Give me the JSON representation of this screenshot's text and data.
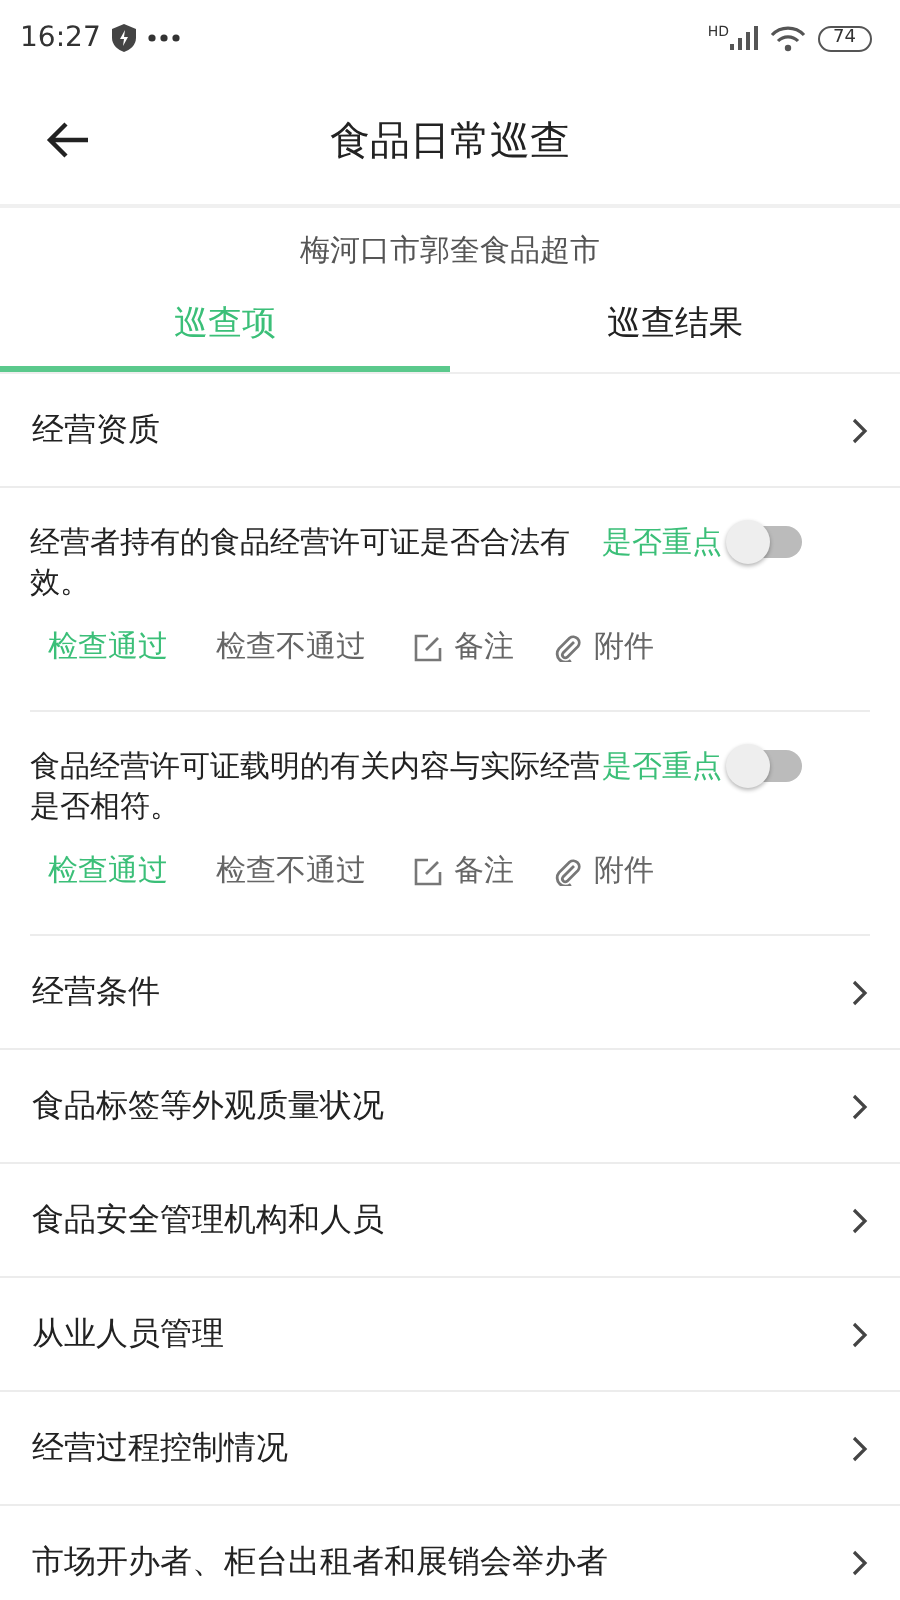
{
  "status_bar": {
    "time": "16:27",
    "network": "HD",
    "battery": "74"
  },
  "header": {
    "title": "食品日常巡查"
  },
  "shop_name": "梅河口市郭奎食品超市",
  "tabs": [
    {
      "label": "巡查项",
      "selected": true
    },
    {
      "label": "巡查结果",
      "selected": false
    }
  ],
  "sections": [
    {
      "title": "经营资质",
      "items": [
        {
          "text": "经营者持有的食品经营许可证是否合法有效。",
          "key_label": "是否重点",
          "key_on": false,
          "results": [
            {
              "label": "检查通过",
              "selected": true
            },
            {
              "label": "检查不通过",
              "selected": false
            }
          ],
          "note_label": "备注",
          "attachment_label": "附件"
        },
        {
          "text": "食品经营许可证载明的有关内容与实际经营是否相符。",
          "key_label": "是否重点",
          "key_on": false,
          "results": [
            {
              "label": "检查通过",
              "selected": true
            },
            {
              "label": "检查不通过",
              "selected": false
            }
          ],
          "note_label": "备注",
          "attachment_label": "附件"
        }
      ]
    },
    {
      "title": "经营条件"
    },
    {
      "title": "食品标签等外观质量状况"
    },
    {
      "title": "食品安全管理机构和人员"
    },
    {
      "title": "从业人员管理"
    },
    {
      "title": "经营过程控制情况"
    },
    {
      "title": "市场开办者、柜台出租者和展销会举办者"
    }
  ]
}
